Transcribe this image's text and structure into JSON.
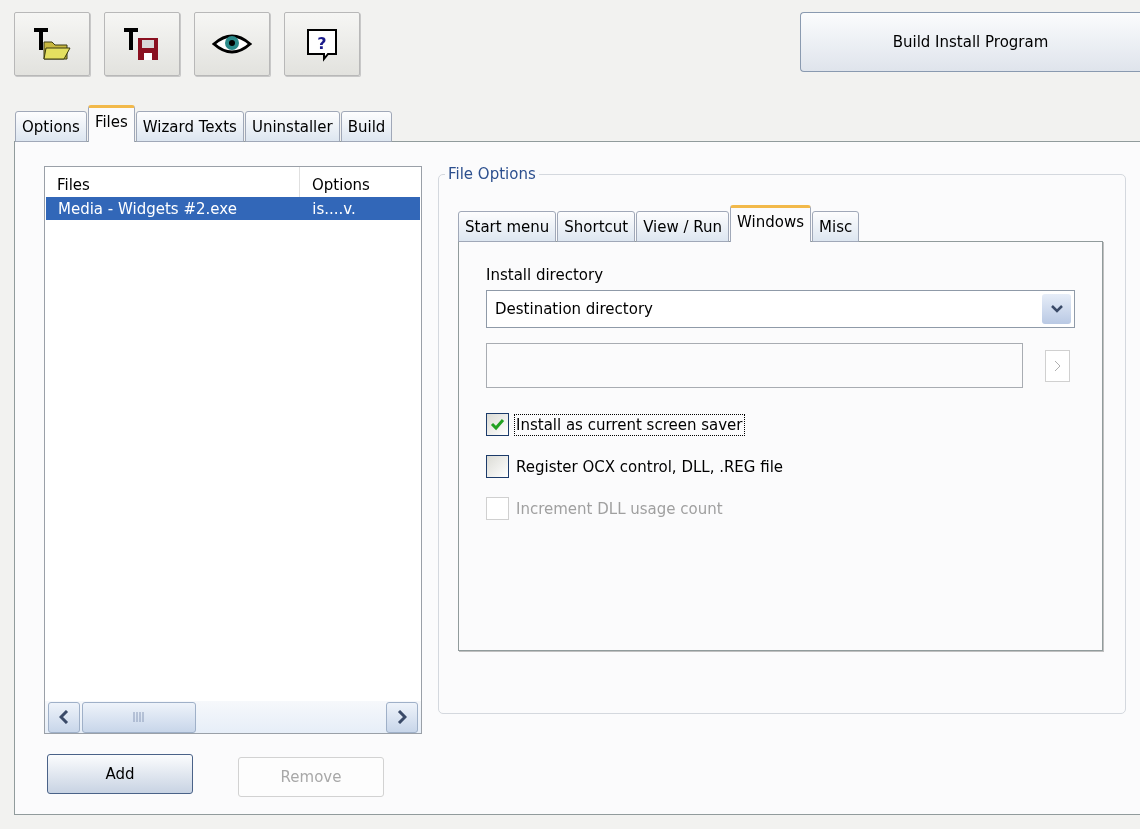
{
  "toolbar": [
    {
      "kind": "open"
    },
    {
      "kind": "save"
    },
    {
      "kind": "preview"
    },
    {
      "kind": "help",
      "glyph": "?"
    }
  ],
  "build_button": {
    "label": "Build Install Program"
  },
  "tabs": [
    {
      "label": "Options",
      "selected": false
    },
    {
      "label": "Files",
      "selected": true
    },
    {
      "label": "Wizard Texts",
      "selected": false
    },
    {
      "label": "Uninstaller",
      "selected": false
    },
    {
      "label": "Build",
      "selected": false
    }
  ],
  "file_list": {
    "columns": [
      "Files",
      "Options"
    ],
    "rows": [
      {
        "cells": [
          "Media - Widgets #2.exe",
          "is....v."
        ],
        "selected": true
      }
    ]
  },
  "file_options": {
    "title": "File Options",
    "tabs": [
      {
        "label": "Start menu",
        "selected": false
      },
      {
        "label": "Shortcut",
        "selected": false
      },
      {
        "label": "View / Run",
        "selected": false
      },
      {
        "label": "Windows",
        "selected": true
      },
      {
        "label": "Misc",
        "selected": false
      }
    ],
    "install_directory": {
      "label": "Install directory",
      "value": "Destination directory"
    },
    "checkboxes": [
      {
        "label": "Install as current screen saver",
        "checked": true,
        "disabled": false,
        "focused": true
      },
      {
        "label": "Register OCX control, DLL, .REG file",
        "checked": false,
        "disabled": false,
        "focused": false
      },
      {
        "label": "Increment DLL usage count",
        "checked": false,
        "disabled": true,
        "focused": false
      }
    ]
  },
  "buttons": [
    {
      "label": "Add",
      "disabled": false
    },
    {
      "label": "Remove",
      "disabled": true
    }
  ]
}
